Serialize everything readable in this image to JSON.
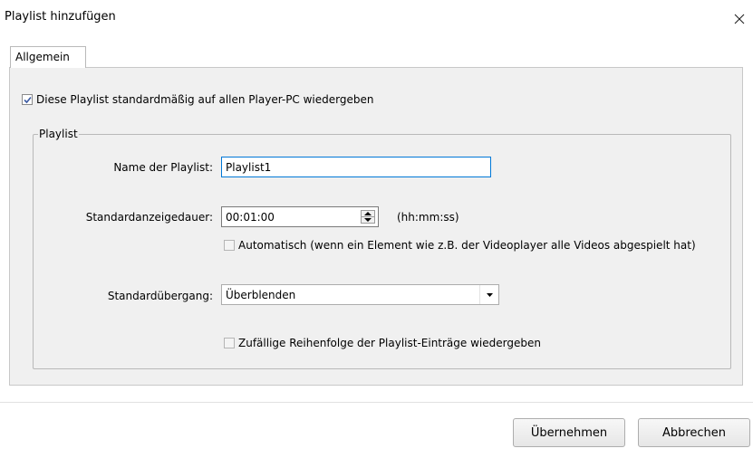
{
  "window": {
    "title": "Playlist hinzufügen"
  },
  "tabs": [
    {
      "label": "Allgemein",
      "selected": true
    }
  ],
  "default_play": {
    "label": "Diese Playlist standardmäßig auf allen Player-PC wiedergeben",
    "checked": true
  },
  "playlist_group": {
    "title": "Playlist",
    "name_label": "Name der Playlist:",
    "name_value": "Playlist1",
    "duration_label": "Standardanzeigedauer:",
    "duration_value": "00:01:00",
    "duration_hint": "(hh:mm:ss)",
    "auto_label": "Automatisch (wenn ein Element wie z.B. der Videoplayer alle Videos abgespielt hat)",
    "auto_checked": false,
    "transition_label": "Standardübergang:",
    "transition_value": "Überblenden",
    "random_label": "Zufällige Reihenfolge der Playlist-Einträge wiedergeben",
    "random_checked": false
  },
  "buttons": {
    "apply": "Übernehmen",
    "cancel": "Abbrechen"
  },
  "colors": {
    "panel": "#f0f0f0",
    "focus_border": "#0078d7",
    "check_mark": "#3b5aa3"
  }
}
